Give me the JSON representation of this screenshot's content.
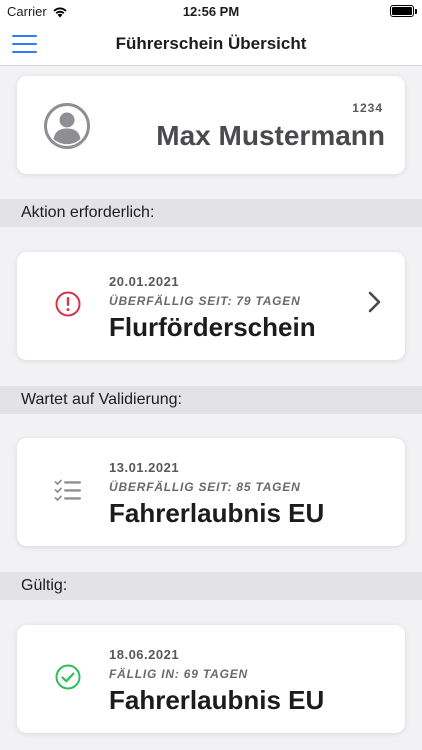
{
  "status_bar": {
    "carrier": "Carrier",
    "time": "12:56 PM"
  },
  "nav": {
    "title": "Führerschein Übersicht",
    "menu_icon": "hamburger-menu-icon",
    "accent_color": "#2f7cf6"
  },
  "profile": {
    "personnel_number": "1234",
    "name": "Max Mustermann",
    "avatar_icon": "user-avatar-icon"
  },
  "sections": [
    {
      "header": "Aktion erforderlich:",
      "item": {
        "date": "20.01.2021",
        "due": "ÜBERFÄLLIG SEIT: 79 TAGEN",
        "name": "Flurförderschein",
        "icon": "exclamation-circle-icon",
        "icon_color": "#d9334a"
      }
    },
    {
      "header": "Wartet auf Validierung:",
      "item": {
        "date": "13.01.2021",
        "due": "ÜBERFÄLLIG SEIT: 85 TAGEN",
        "name": "Fahrerlaubnis EU",
        "icon": "checklist-icon",
        "icon_color": "#8e8e93"
      }
    },
    {
      "header": "Gültig:",
      "item": {
        "date": "18.06.2021",
        "due": "FÄLLIG IN: 69 TAGEN",
        "name": "Fahrerlaubnis EU",
        "icon": "check-circle-icon",
        "icon_color": "#2fbf5a"
      }
    }
  ]
}
